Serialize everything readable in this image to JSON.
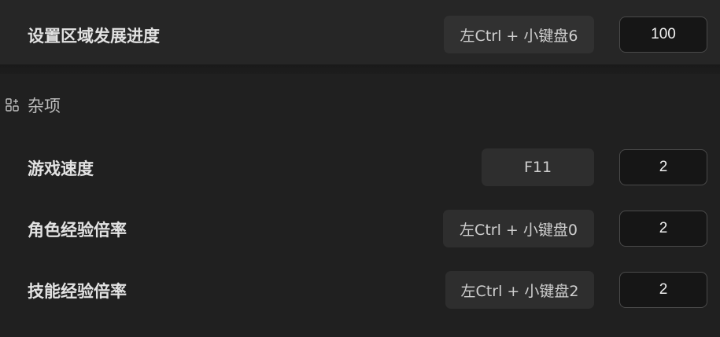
{
  "rows_top": {
    "label": "设置区域发展进度",
    "hotkey": "左Ctrl + 小键盘6",
    "value": "100"
  },
  "section": {
    "icon": "grid-plus-icon",
    "title": "杂项"
  },
  "rows": [
    {
      "label": "游戏速度",
      "hotkey": "F11",
      "value": "2"
    },
    {
      "label": "角色经验倍率",
      "hotkey": "左Ctrl + 小键盘0",
      "value": "2"
    },
    {
      "label": "技能经验倍率",
      "hotkey": "左Ctrl + 小键盘2",
      "value": "2"
    }
  ]
}
